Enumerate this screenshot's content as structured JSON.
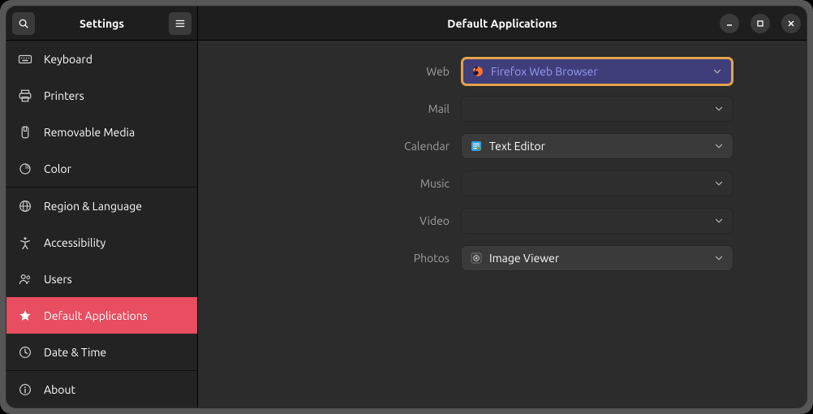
{
  "header": {
    "sidebar_title": "Settings",
    "main_title": "Default Applications"
  },
  "sidebar": {
    "items": [
      {
        "icon": "keyboard-icon",
        "label": "Keyboard",
        "active": false
      },
      {
        "icon": "printer-icon",
        "label": "Printers",
        "active": false
      },
      {
        "icon": "drive-icon",
        "label": "Removable Media",
        "active": false
      },
      {
        "icon": "color-icon",
        "label": "Color",
        "active": false
      },
      {
        "separator": true
      },
      {
        "icon": "globe-icon",
        "label": "Region & Language",
        "active": false
      },
      {
        "icon": "accessibility-icon",
        "label": "Accessibility",
        "active": false
      },
      {
        "icon": "users-icon",
        "label": "Users",
        "active": false
      },
      {
        "icon": "star-icon",
        "label": "Default Applications",
        "active": true
      },
      {
        "icon": "clock-icon",
        "label": "Date & Time",
        "active": false
      },
      {
        "separator": true
      },
      {
        "icon": "info-icon",
        "label": "About",
        "active": false
      }
    ]
  },
  "main": {
    "rows": [
      {
        "label": "Web",
        "app_icon": "firefox-icon",
        "value": "Firefox Web Browser",
        "highlight": true,
        "light": false
      },
      {
        "label": "Mail",
        "app_icon": "",
        "value": "",
        "highlight": false,
        "light": false
      },
      {
        "label": "Calendar",
        "app_icon": "texteditor-icon",
        "value": "Text Editor",
        "highlight": false,
        "light": true
      },
      {
        "label": "Music",
        "app_icon": "",
        "value": "",
        "highlight": false,
        "light": false
      },
      {
        "label": "Video",
        "app_icon": "",
        "value": "",
        "highlight": false,
        "light": false
      },
      {
        "label": "Photos",
        "app_icon": "imageviewer-icon",
        "value": "Image Viewer",
        "highlight": false,
        "light": true
      }
    ]
  }
}
